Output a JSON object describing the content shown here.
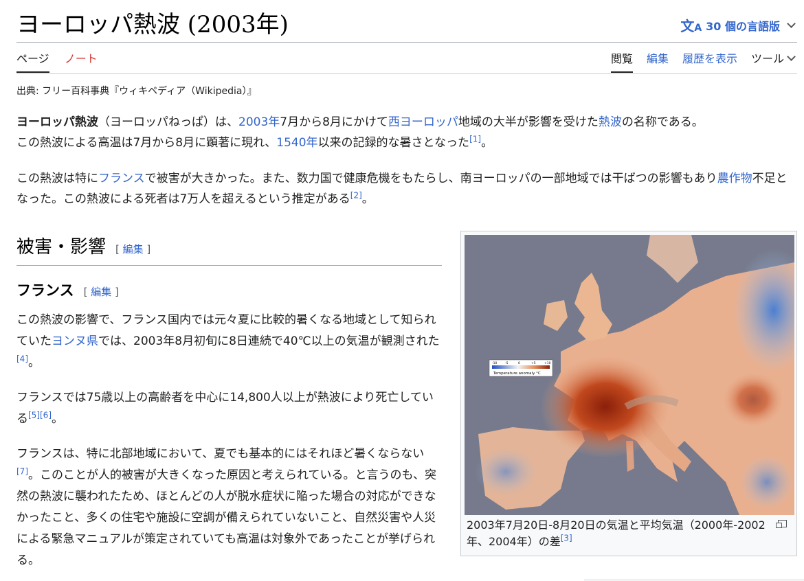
{
  "header": {
    "title": "ヨーロッパ熱波 (2003年)",
    "languages_label": "30 個の言語版",
    "language_icon": "translate-icon"
  },
  "tabs": {
    "page": "ページ",
    "talk": "ノート",
    "read": "閲覧",
    "edit": "編集",
    "history": "履歴を表示",
    "tools": "ツール"
  },
  "source_line": "出典: フリー百科事典『ウィキペディア（Wikipedia）』",
  "intro": {
    "p1": {
      "bold": "ヨーロッパ熱波",
      "t1": "（ヨーロッパねっぱ）は、",
      "l_year": "2003年",
      "t2": "7月から8月にかけて",
      "l_west": "西ヨーロッパ",
      "t3": "地域の大半が影響を受けた",
      "l_heat": "熱波",
      "t4": "の名称である。",
      "t5": "この熱波による高温は7月から8月に顕著に現れ、",
      "l_1540": "1540年",
      "t6": "以来の記録的な暑さとなった",
      "ref": "[1]",
      "t7": "。"
    },
    "p2": {
      "t1": "この熱波は特に",
      "l_france": "フランス",
      "t2": "で被害が大きかった。また、数力国で健康危機をもたらし、南ヨーロッパの一部地域では干ばつの影響もあり",
      "l_crops": "農作物",
      "t3": "不足となった。この熱波による死者は7万人を超えるという推定がある",
      "ref": "[2]",
      "t4": "。"
    }
  },
  "section": {
    "title": "被害・影響",
    "edit_open": "[ ",
    "edit": "編集",
    "edit_close": " ]"
  },
  "subsection": {
    "title": "フランス",
    "edit_open": "[ ",
    "edit": "編集",
    "edit_close": " ]"
  },
  "france": {
    "p1": {
      "t1": "この熱波の影響で、フランス国内では元々夏に比較的暑くなる地域として知られていた",
      "l_yonne": "ヨンヌ県",
      "t2": "では、2003年8月初旬に8日連続で40℃以上の気温が観測された",
      "ref": "[4]",
      "t3": "。"
    },
    "p2": {
      "t1": "フランスでは75歳以上の高齢者を中心に14,800人以上が熱波により死亡している",
      "ref1": "[5]",
      "ref2": "[6]",
      "t2": "。"
    },
    "p3": {
      "t1": "フランスは、特に北部地域において、夏でも基本的にはそれほど暑くならない",
      "ref": "[7]",
      "t2": "。このことが人的被害が大きくなった原因と考えられている。と言うのも、突然の熱波に襲われたため、ほとんどの人が脱水症状に陥った場合の対応ができなかったこと、多くの住宅や施設に空調が備えられていないこと、自然災害や人災による緊急マニュアルが策定されていても高温は対象外であったことが挙げられる。"
    }
  },
  "figure": {
    "legend_ticks": [
      "-10",
      "-5",
      "0",
      "+5",
      "+10"
    ],
    "legend_label": "Temperature anomaly °C",
    "caption": "2003年7月20日-8月20日の気温と平均気温（2000年-2002年、2004年）の差",
    "caption_ref": "[3]"
  },
  "colors": {
    "link": "#3366cc",
    "new_link": "#d73333",
    "text": "#202122",
    "sea": "#767a8c"
  }
}
